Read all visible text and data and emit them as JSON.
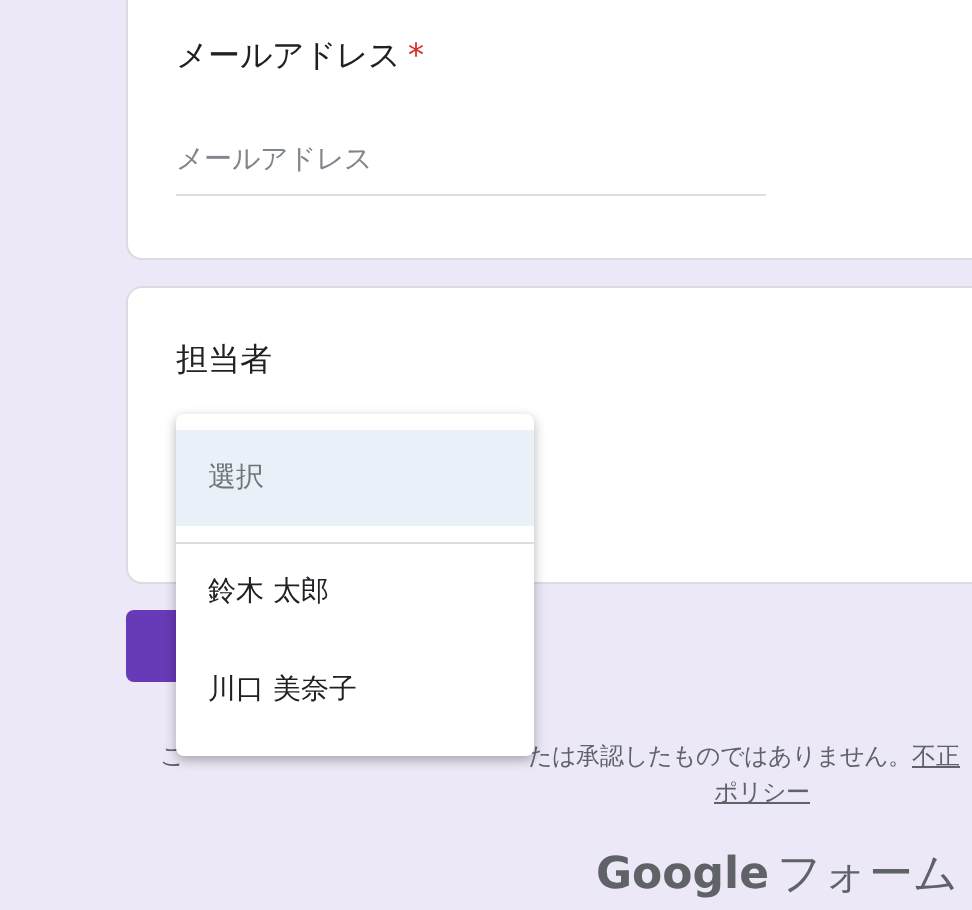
{
  "questions": [
    {
      "kind": "text",
      "title": "メールアドレス",
      "required_mark": "*",
      "placeholder": "メールアドレス"
    },
    {
      "kind": "dropdown",
      "title": "担当者",
      "expanded": true,
      "options": [
        {
          "label": "選択",
          "kind": "placeholder",
          "selected": true
        },
        {
          "label": "鈴木 太郎",
          "kind": "option",
          "selected": false
        },
        {
          "label": "川口 美奈子",
          "kind": "option",
          "selected": false
        }
      ]
    }
  ],
  "submit_button": {
    "kind": "primary"
  },
  "footer": {
    "lead": "こ",
    "text": "たは承認したものではありません。",
    "links": [
      "不正",
      "ポリシー"
    ]
  },
  "brand": {
    "logo": "Google",
    "product": "フォーム"
  }
}
